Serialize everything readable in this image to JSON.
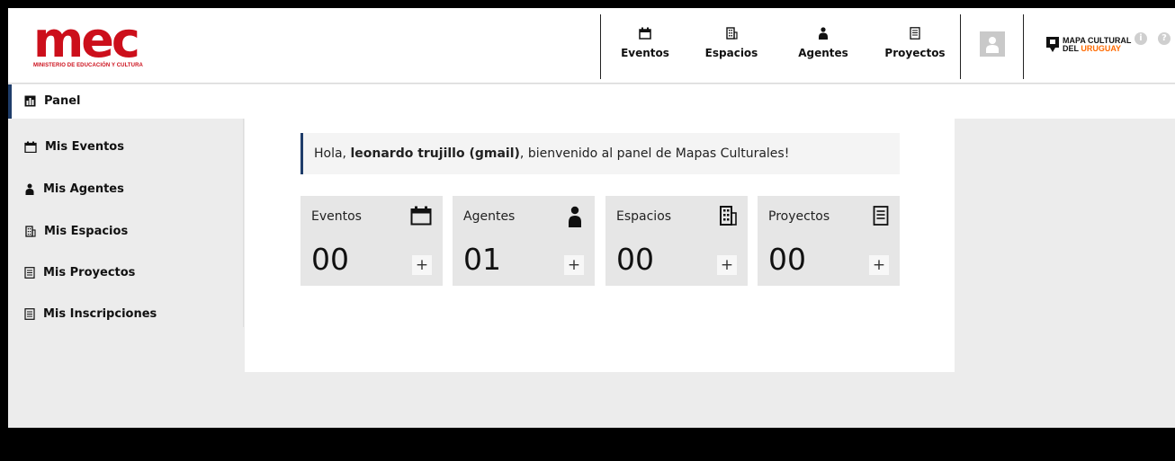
{
  "header": {
    "logo_text": "mec",
    "logo_subtitle": "MINISTERIO DE EDUCACIÓN Y CULTURA",
    "nav": [
      {
        "label": "Eventos",
        "icon": "calendar-icon"
      },
      {
        "label": "Espacios",
        "icon": "building-icon"
      },
      {
        "label": "Agentes",
        "icon": "person-icon"
      },
      {
        "label": "Proyectos",
        "icon": "document-icon"
      }
    ],
    "brand_line1": "MAPA CULTURAL",
    "brand_line2_prefix": "DEL",
    "brand_line2_accent": "URUGUAY",
    "info_icon": "i",
    "help_icon": "?"
  },
  "sidebar": {
    "items": [
      {
        "label": "Panel",
        "icon": "panel-icon",
        "active": true
      },
      {
        "label": "Mis Eventos",
        "icon": "calendar-icon"
      },
      {
        "label": "Mis Agentes",
        "icon": "person-icon"
      },
      {
        "label": "Mis Espacios",
        "icon": "building-icon"
      },
      {
        "label": "Mis Proyectos",
        "icon": "document-icon"
      },
      {
        "label": "Mis Inscripciones",
        "icon": "document-icon"
      }
    ]
  },
  "greeting": {
    "prefix": "Hola, ",
    "name": "leonardo trujillo (gmail)",
    "suffix": ", bienvenido al panel de Mapas Culturales!"
  },
  "cards": [
    {
      "title": "Eventos",
      "count": "00",
      "icon": "calendar-icon",
      "plus": "+"
    },
    {
      "title": "Agentes",
      "count": "01",
      "icon": "person-icon",
      "plus": "+"
    },
    {
      "title": "Espacios",
      "count": "00",
      "icon": "building-icon",
      "plus": "+"
    },
    {
      "title": "Proyectos",
      "count": "00",
      "icon": "document-icon",
      "plus": "+"
    }
  ],
  "colors": {
    "brand_red": "#cc0f1b",
    "brand_orange": "#ff6a00",
    "accent_navy": "#1f3d6a"
  }
}
